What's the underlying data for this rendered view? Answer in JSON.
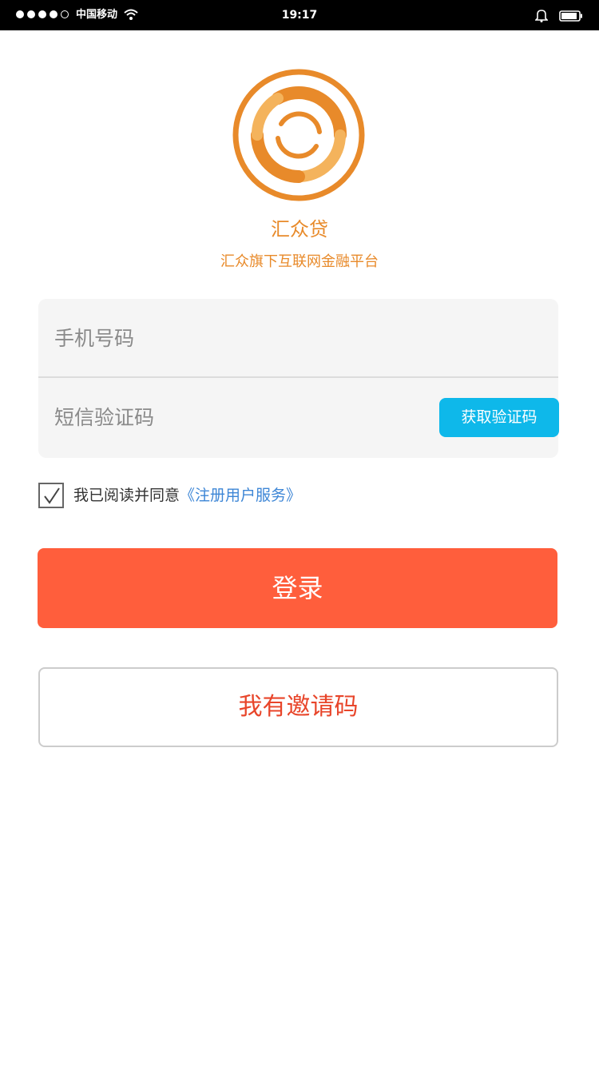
{
  "status_bar": {
    "carrier": "中国移动",
    "time": "19:17"
  },
  "brand": {
    "name": "汇众贷",
    "tagline": "汇众旗下互联网金融平台",
    "color": "#e88a2a"
  },
  "form": {
    "phone_placeholder": "手机号码",
    "sms_placeholder": "短信验证码",
    "get_code_label": "获取验证码",
    "agree_checked": true,
    "agree_text": "我已阅读并同意",
    "agree_link": "《注册用户服务》"
  },
  "actions": {
    "login_label": "登录",
    "invite_label": "我有邀请码"
  },
  "colors": {
    "login": "#ff5e3c",
    "get_code": "#0eb8ea",
    "link": "#3d86d6",
    "invite_text": "#e8452a"
  },
  "icons": {
    "wifi": "wifi-icon",
    "bell": "bell-icon",
    "battery": "battery-icon",
    "logo": "logo-icon",
    "check": "check-icon"
  }
}
